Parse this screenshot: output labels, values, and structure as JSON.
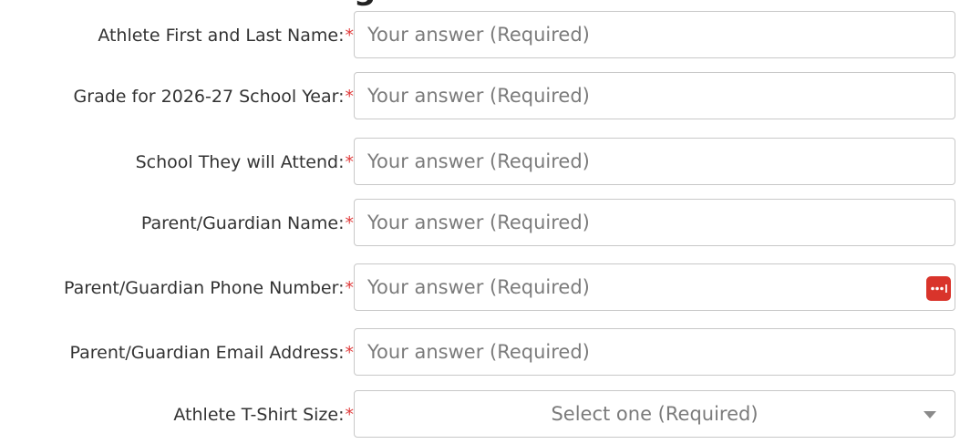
{
  "form": {
    "required_marker": "*",
    "fields": [
      {
        "label": "Athlete First and Last Name:",
        "placeholder": "Your answer (Required)"
      },
      {
        "label": "Grade for 2026-27 School Year:",
        "placeholder": "Your answer (Required)"
      },
      {
        "label": "School They will Attend:",
        "placeholder": "Your answer (Required)"
      },
      {
        "label": "Parent/Guardian Name:",
        "placeholder": "Your answer (Required)"
      },
      {
        "label": "Parent/Guardian Phone Number:",
        "placeholder": "Your answer (Required)",
        "extension_icon": "password-manager-icon"
      },
      {
        "label": "Parent/Guardian Email Address:",
        "placeholder": "Your answer (Required)"
      }
    ],
    "tshirt": {
      "label": "Athlete T-Shirt Size:",
      "selected": "Select one (Required)",
      "icon": "chevron-down-icon"
    }
  },
  "colors": {
    "required": "#e03a3a",
    "password_icon_bg": "#d9342b",
    "border": "#c8c8c8",
    "placeholder": "#7b7b7b",
    "label": "#333333"
  }
}
